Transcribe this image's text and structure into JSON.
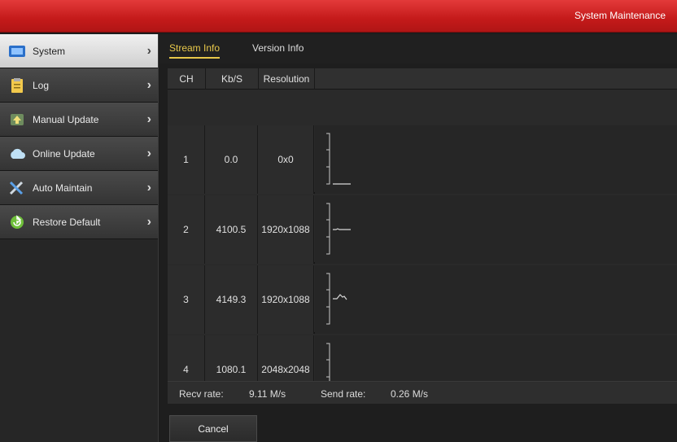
{
  "header": {
    "title": "System Maintenance"
  },
  "sidebar": {
    "items": [
      {
        "label": "System",
        "icon": "system-icon"
      },
      {
        "label": "Log",
        "icon": "log-icon"
      },
      {
        "label": "Manual Update",
        "icon": "manual-update-icon"
      },
      {
        "label": "Online Update",
        "icon": "cloud-icon"
      },
      {
        "label": "Auto Maintain",
        "icon": "tools-icon"
      },
      {
        "label": "Restore Default",
        "icon": "restore-icon"
      }
    ]
  },
  "tabs": [
    {
      "label": "Stream Info"
    },
    {
      "label": "Version Info"
    }
  ],
  "table": {
    "headers": {
      "ch": "CH",
      "kbs": "Kb/S",
      "resolution": "Resolution"
    },
    "rows": [
      {
        "ch": "1",
        "kbs": "0.0",
        "resolution": "0x0"
      },
      {
        "ch": "2",
        "kbs": "4100.5",
        "resolution": "1920x1088"
      },
      {
        "ch": "3",
        "kbs": "4149.3",
        "resolution": "1920x1088"
      },
      {
        "ch": "4",
        "kbs": "1080.1",
        "resolution": "2048x2048"
      }
    ]
  },
  "footer": {
    "recv_label": "Recv rate:",
    "recv_value": "9.11 M/s",
    "send_label": "Send rate:",
    "send_value": "0.26 M/s"
  },
  "buttons": {
    "cancel": "Cancel"
  },
  "colors": {
    "accent": "#e8c84a",
    "topbar": "#c41a1a"
  }
}
